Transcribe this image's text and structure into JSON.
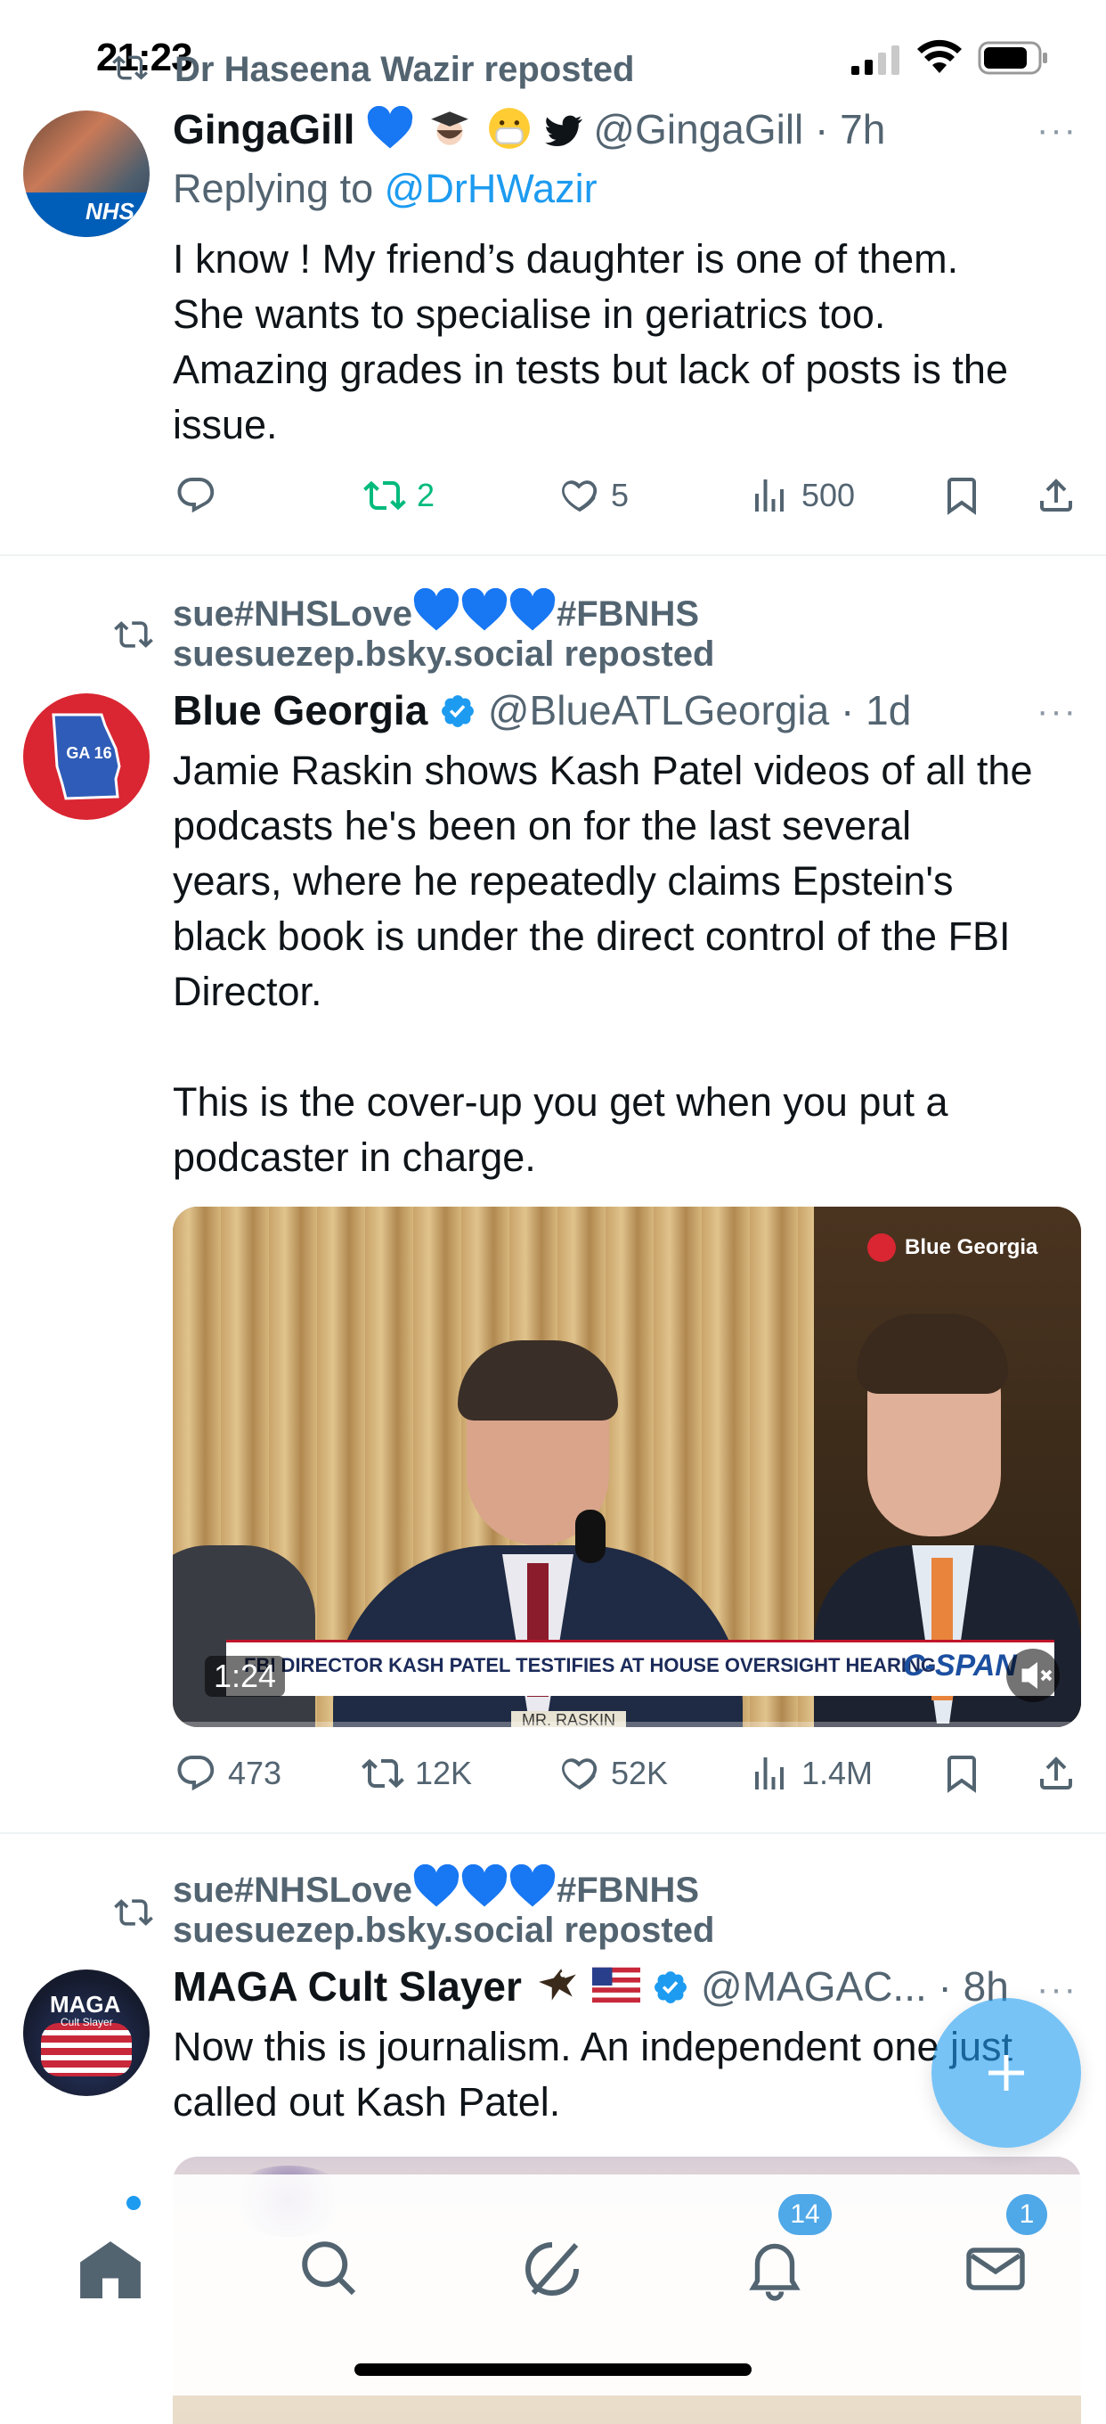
{
  "status_bar": {
    "time": "21:23"
  },
  "tweets": [
    {
      "repost_by": "Dr Haseena Wazir reposted",
      "name": "GingaGill",
      "handle": "@GingaGill",
      "time": "· 7h",
      "reply_prefix": "Replying to",
      "reply_to": "@DrHWazir",
      "text_lines": [
        "I know ! My friend’s daughter is one of them.",
        "She wants to specialise in geriatrics too.",
        "Amazing grades in tests but lack of posts is the",
        "issue."
      ],
      "avatar_label": "NHS",
      "stats": {
        "replies": "",
        "reposts": "2",
        "likes": "5",
        "views": "500"
      }
    },
    {
      "repost_by_line1": "sue#NHSLove",
      "repost_by_tag": "#FBNHS",
      "repost_by_line2": "suesuezep.bsky.social reposted",
      "name": "Blue Georgia",
      "handle": "@BlueATLGeorgia",
      "time": "· 1d",
      "avatar_label": "GA 16",
      "text_lines": [
        "Jamie Raskin shows Kash Patel videos of all the",
        "podcasts he's been on for the last several",
        "years, where he repeatedly claims Epstein's",
        "black book is under the direct control of the FBI",
        "Director.",
        "",
        "This is the cover-up you get when you put a",
        "podcaster in charge."
      ],
      "video": {
        "watermark": "Blue Georgia",
        "duration": "1:24",
        "chyron": "FBI DIRECTOR KASH PATEL TESTIFIES AT HOUSE OVERSIGHT HEARING",
        "network": "C-SPAN",
        "nameplate": "MR. RASKIN"
      },
      "stats": {
        "replies": "473",
        "reposts": "12K",
        "likes": "52K",
        "views": "1.4M"
      }
    },
    {
      "repost_by_line1": "sue#NHSLove",
      "repost_by_tag": "#FBNHS",
      "repost_by_line2": "suesuezep.bsky.social reposted",
      "name": "MAGA Cult Slayer",
      "handle": "@MAGAC...",
      "time": "· 8h",
      "avatar_label": "MAGA",
      "avatar_sub": "Cult Slayer",
      "text_lines": [
        "Now this is journalism. An independent one just",
        "called out Kash Patel."
      ]
    }
  ],
  "tab_bar": {
    "items": [
      "home",
      "search",
      "grok",
      "notifications",
      "messages"
    ],
    "notifications_badge": "14",
    "messages_badge": "1"
  },
  "colors": {
    "accent": "#1d9bf0",
    "repost_green": "#00ba7c",
    "secondary": "#536471",
    "heart_blue": "#1877f2"
  },
  "icons": [
    "repost-icon",
    "reply-icon",
    "like-icon",
    "views-icon",
    "bookmark-icon",
    "share-icon",
    "verified-icon",
    "home-icon",
    "search-icon",
    "grok-icon",
    "bell-icon",
    "mail-icon",
    "compose-icon"
  ]
}
